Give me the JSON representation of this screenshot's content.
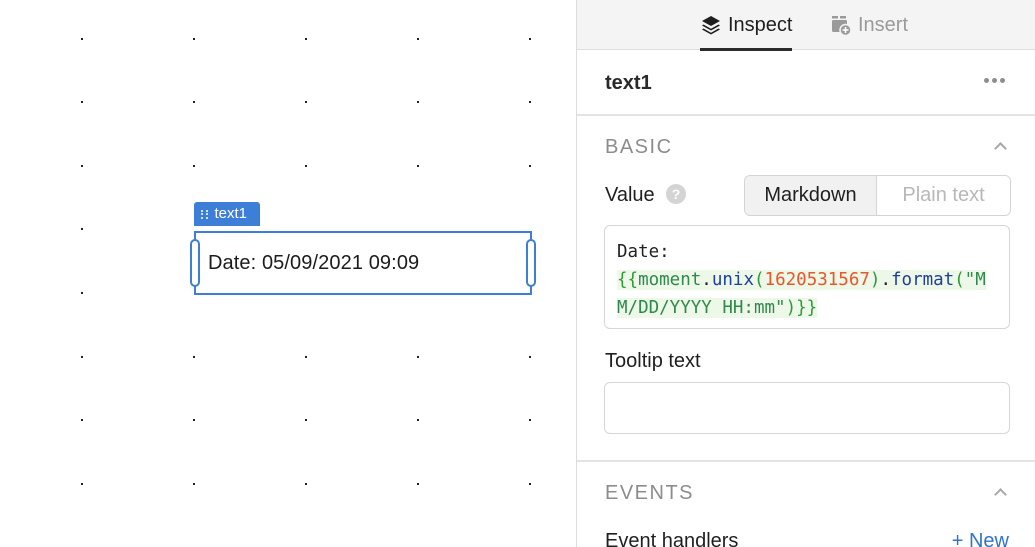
{
  "canvas": {
    "component": {
      "tag_label": "text1",
      "rendered_text": "Date: 05/09/2021 09:09"
    }
  },
  "panel": {
    "tabs": [
      {
        "label": "Inspect",
        "icon": "layers-icon",
        "active": true
      },
      {
        "label": "Insert",
        "icon": "insert-component-icon",
        "active": false
      }
    ],
    "component_name": "text1",
    "more_icon": "ellipsis-icon",
    "basic": {
      "title": "BASIC",
      "value_label": "Value",
      "help_icon": "?",
      "mode_options": [
        "Markdown",
        "Plain text"
      ],
      "selected_mode": "Markdown",
      "code": {
        "line1": "Date:",
        "tokens": {
          "open": "{{",
          "obj": "moment",
          "dot1": ".",
          "method1": "unix",
          "paren_open1": "(",
          "number": "1620531567",
          "paren_close1": ")",
          "dot2": ".",
          "method2": "format",
          "paren_open2": "(",
          "string_part1": "\"M",
          "string_part2": "M/DD/YYYY HH:mm\"",
          "paren_close2": ")",
          "close": "}}"
        }
      },
      "tooltip_label": "Tooltip text",
      "tooltip_value": "",
      "tooltip_placeholder": ""
    },
    "events": {
      "title": "EVENTS",
      "handlers_label": "Event handlers",
      "new_button": "+ New"
    }
  },
  "colors": {
    "accent": "#3d7fd6",
    "link": "#2f74d0",
    "code_number": "#e8562a",
    "code_method": "#1d3f9e",
    "code_string": "#2e8a4a"
  }
}
